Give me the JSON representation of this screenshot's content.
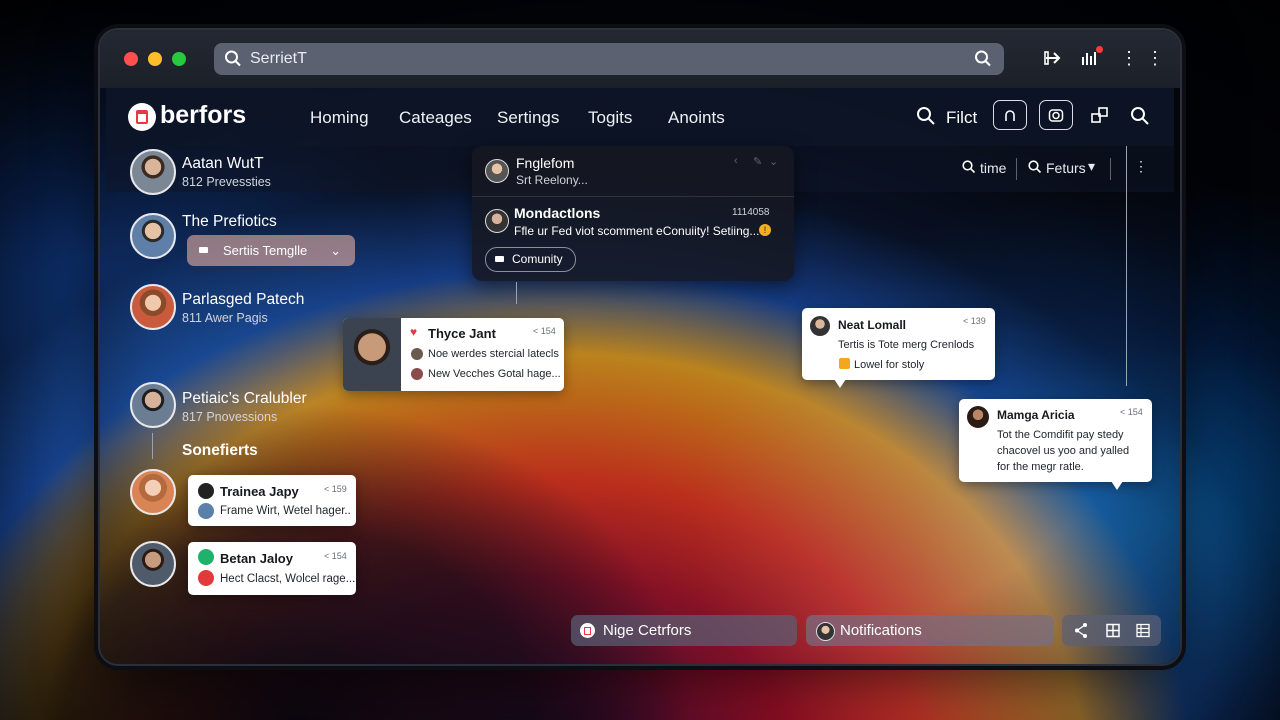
{
  "browser": {
    "url_text": "SerrietT"
  },
  "header": {
    "logo": "berfors",
    "nav": [
      "Homing",
      "Cateages",
      "Sertings",
      "Togits",
      "Anoints"
    ],
    "filter_label": "Filct"
  },
  "subbar": {
    "time_label": "time",
    "filters_label": "Feturs"
  },
  "sidebar": {
    "people": [
      {
        "name": "Aatan WutT",
        "sub": "812 Prevessties"
      },
      {
        "name": "The Prefiotics",
        "sub": ""
      },
      {
        "name": "Parlasged Patech",
        "sub": "811 Awer Pagis"
      },
      {
        "name": "Petiaic’s Cralubler",
        "sub": "817 Pnovessions"
      }
    ],
    "pill_label": "Sertiis Temglle",
    "section_label": "Sonefierts"
  },
  "panel": {
    "item1_title": "Fnglefom",
    "item1_sub": "Srt Reelony...",
    "item2_title": "Mondactlons",
    "item2_time": "1114058",
    "item2_text": "Ffle ur Fed viot scomment eConuiity! Setiing...",
    "community_label": "Comunity"
  },
  "cards": {
    "thyce": {
      "title": "Thyce Jant",
      "time": "< 154",
      "line1": "Noe werdes stercial latecls",
      "line2": "New Vecches Gotal hage..."
    },
    "trainea": {
      "title": "Trainea Japy",
      "time": "< 159",
      "line1": "Frame Wirt, Wetel hager.."
    },
    "betan": {
      "title": "Betan Jaloy",
      "time": "< 154",
      "line1": "Hect Clacst, Wolcel rage..."
    },
    "neat": {
      "title": "Neat Lomall",
      "time": "< 139",
      "line1": "Tertis is Tote merg Crenlods",
      "line2": "Lowel for stoly"
    },
    "manga": {
      "title": "Mamga Aricia",
      "time": "< 154",
      "line1": "Tot the Comdifit pay stedy",
      "line2": "chacovel us yoo and yalled",
      "line3": "for the megr ratle."
    }
  },
  "bottom": {
    "left_label": "Nige Cetrfors",
    "notif_label": "Notifications"
  },
  "colors": {
    "accent_red": "#e53946",
    "panel_dark": "#161822",
    "card_white": "#ffffff"
  },
  "icons": [
    "search-icon",
    "share-icon",
    "chart-icon",
    "more-icon",
    "fingerprint-icon",
    "camera-icon",
    "switch-icon",
    "heart-icon",
    "grid-icon"
  ]
}
